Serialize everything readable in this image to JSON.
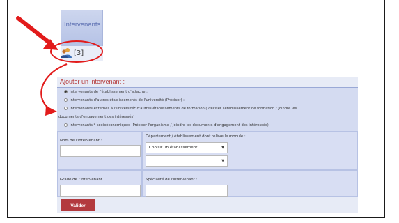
{
  "colors": {
    "accent_red": "#e21b1b",
    "tab_blue": "#b5c2e6",
    "form_bg": "#e7ebf6",
    "button": "#b33a3e",
    "title": "#b53a3a"
  },
  "tab": {
    "label": "Intervenants"
  },
  "counter": {
    "text": "[3]",
    "icon": "people-icon"
  },
  "form": {
    "title": "Ajouter un intervenant :",
    "options": [
      {
        "label": "Intervenants de l'établissement d'attache :",
        "checked": true
      },
      {
        "label": "Intervenants d'autres établissements de l'université (Préciser) :",
        "checked": false
      },
      {
        "label": "Intervenants externes à l'université* d'autres établissements de formation (Préciser l'établissement de formation / Joindre les",
        "checked": false
      },
      {
        "label": "documents d'engagement des intéressés)",
        "continuation": true
      },
      {
        "label": "Intervenants * socioéconomiques (Préciser l'organisme / Joindre les documents d'engagement des intéressés)",
        "checked": false
      }
    ],
    "fields": {
      "name_label": "Nom de l'intervenant :",
      "dept_label": "Département / établissement dont relève le module :",
      "establishment_select": "Choisir un établissement",
      "second_select": "",
      "grade_label": "Grade de l'intervenant :",
      "specialty_label": "Spécialité de l'intervenant :"
    },
    "submit_label": "Valider"
  }
}
